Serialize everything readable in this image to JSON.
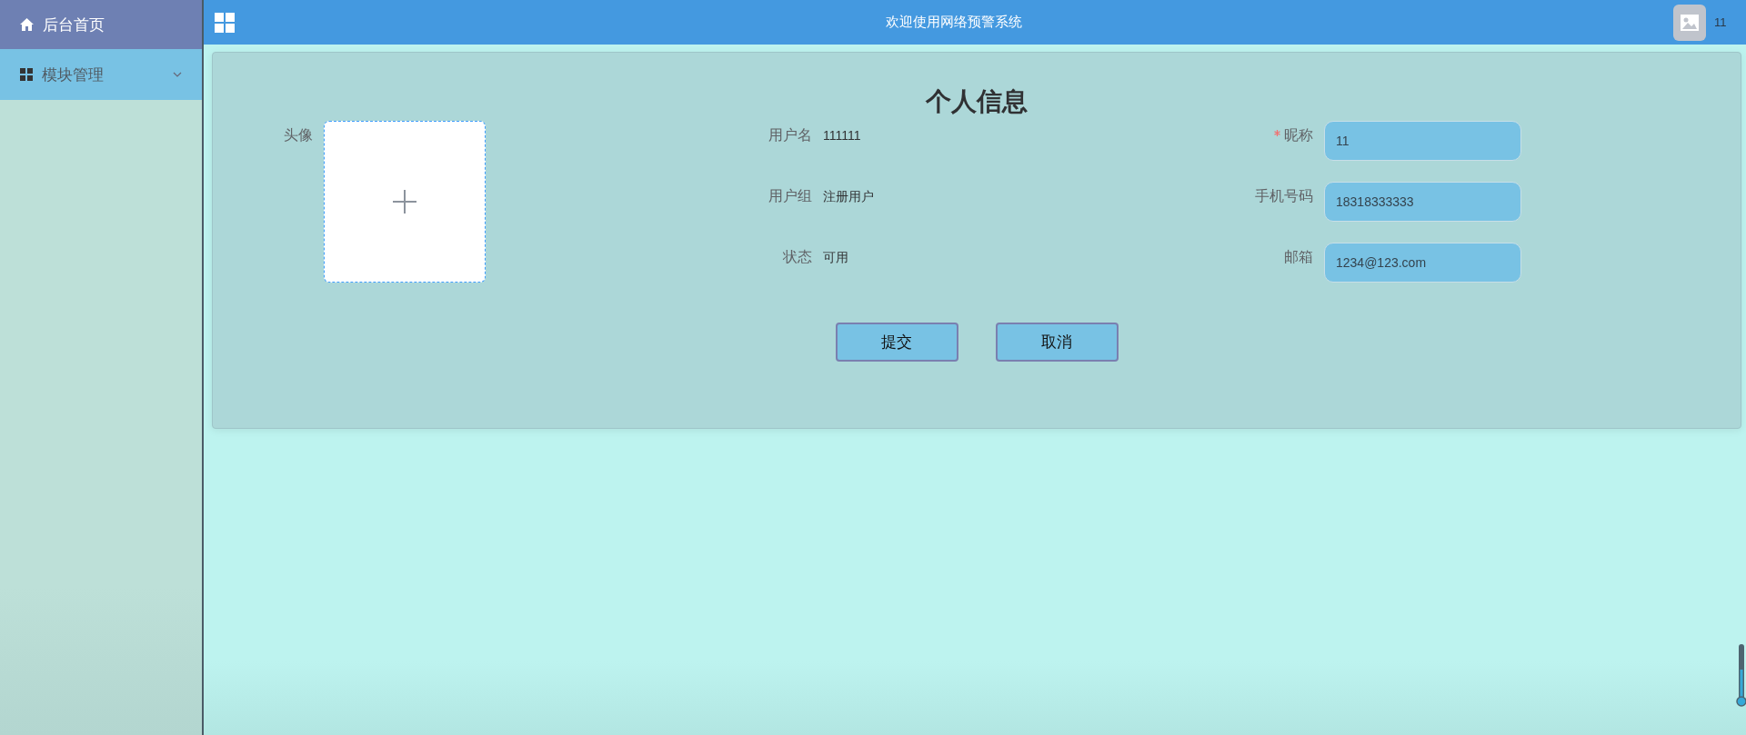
{
  "sidebar": {
    "items": [
      {
        "label": "后台首页",
        "kind": "link",
        "selected": true
      },
      {
        "label": "模块管理",
        "kind": "submenu",
        "selected": false,
        "expanded": false
      }
    ]
  },
  "topbar": {
    "title": "欢迎使用网络预警系统",
    "user": "11"
  },
  "profile": {
    "title": "个人信息",
    "avatar": {
      "label": "头像"
    },
    "info": [
      {
        "label": "用户名",
        "value": "111111"
      },
      {
        "label": "用户组",
        "value": "注册用户"
      },
      {
        "label": "状态",
        "value": "可用"
      }
    ],
    "fields": [
      {
        "label": "昵称",
        "value": "11",
        "required": true
      },
      {
        "label": "手机号码",
        "value": "18318333333",
        "required": false
      },
      {
        "label": "邮箱",
        "value": "1234@123.com",
        "required": false
      }
    ],
    "buttons": [
      "提交",
      "取消"
    ]
  }
}
